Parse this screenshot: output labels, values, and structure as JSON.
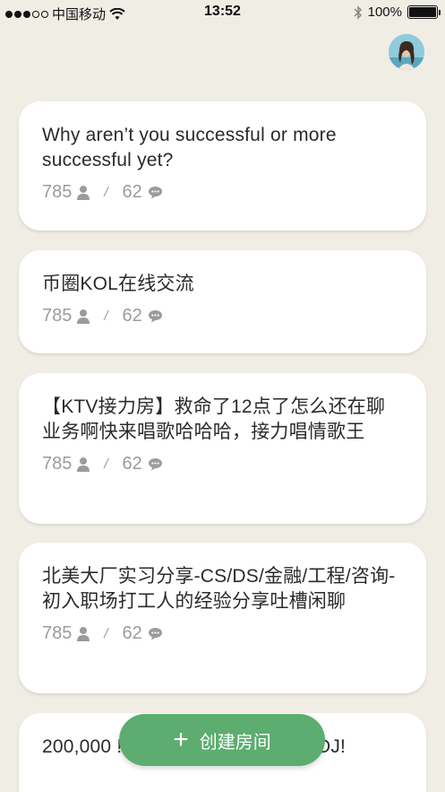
{
  "status_bar": {
    "carrier": "中国移动",
    "time": "13:52",
    "battery": "100%"
  },
  "rooms": [
    {
      "title": "Why aren’t you successful or more successful yet?",
      "listeners": "785",
      "messages": "62"
    },
    {
      "title": "币圈KOL在线交流",
      "listeners": "785",
      "messages": "62"
    },
    {
      "title": "【KTV接力房】救命了12点了怎么还在聊业务啊快来唱歌哈哈哈，接力唱情歌王",
      "listeners": "785",
      "messages": "62"
    },
    {
      "title": "北美大厂实习分享-CS/DS/金融/工程/咨询-初入职场打工人的经验分享吐槽闲聊",
      "listeners": "785",
      "messages": "62"
    },
    {
      "title": "200,000 !!! Come cibe.We got a DJ!",
      "listeners": "",
      "messages": ""
    }
  ],
  "fab": {
    "icon": "plus-icon",
    "label": "创建房间"
  },
  "colors": {
    "background": "#f0ede5",
    "card": "#ffffff",
    "accent": "#5cad6f",
    "meta": "#9b9b9b"
  }
}
